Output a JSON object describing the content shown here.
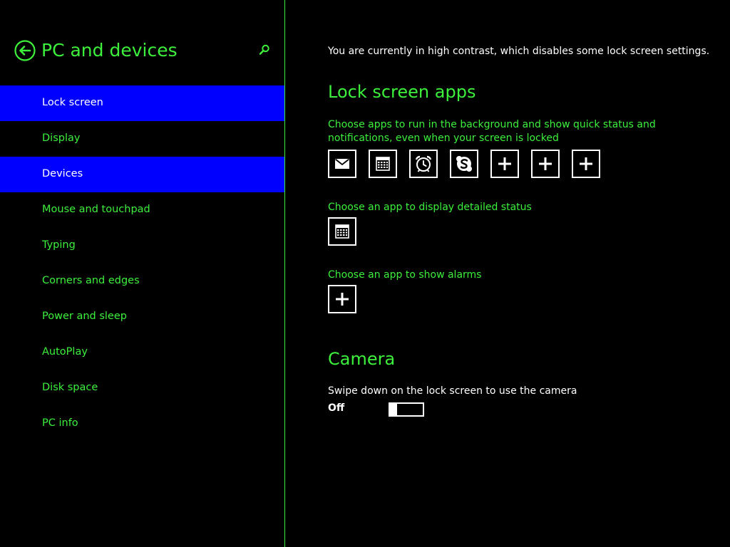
{
  "sidebar": {
    "title": "PC and devices",
    "items": [
      {
        "label": "Lock screen",
        "selected": true
      },
      {
        "label": "Display",
        "selected": false
      },
      {
        "label": "Devices",
        "selected": true
      },
      {
        "label": "Mouse and touchpad",
        "selected": false
      },
      {
        "label": "Typing",
        "selected": false
      },
      {
        "label": "Corners and edges",
        "selected": false
      },
      {
        "label": "Power and sleep",
        "selected": false
      },
      {
        "label": "AutoPlay",
        "selected": false
      },
      {
        "label": "Disk space",
        "selected": false
      },
      {
        "label": "PC info",
        "selected": false
      }
    ],
    "icons": {
      "back": "back-arrow-icon",
      "search": "search-icon"
    }
  },
  "main": {
    "notice": "You are currently in high contrast, which disables some lock screen settings.",
    "lock_screen_apps": {
      "title": "Lock screen apps",
      "background_apps_desc": "Choose apps to run in the background and show quick status and notifications, even when your screen is locked",
      "background_apps": [
        "mail-icon",
        "calendar-icon",
        "alarm-clock-icon",
        "skype-icon",
        "add-icon",
        "add-icon",
        "add-icon"
      ],
      "detailed_status_desc": "Choose an app to display detailed status",
      "detailed_status_app": "calendar-icon",
      "alarms_desc": "Choose an app to show alarms",
      "alarms_app": "add-icon"
    },
    "camera": {
      "title": "Camera",
      "desc": "Swipe down on the lock screen to use the camera",
      "toggle_label": "Off",
      "toggle_on": false
    }
  },
  "colors": {
    "background": "#000000",
    "accent_text": "#3cf03c",
    "selection": "#0000ff",
    "body_text": "#ffffff"
  }
}
